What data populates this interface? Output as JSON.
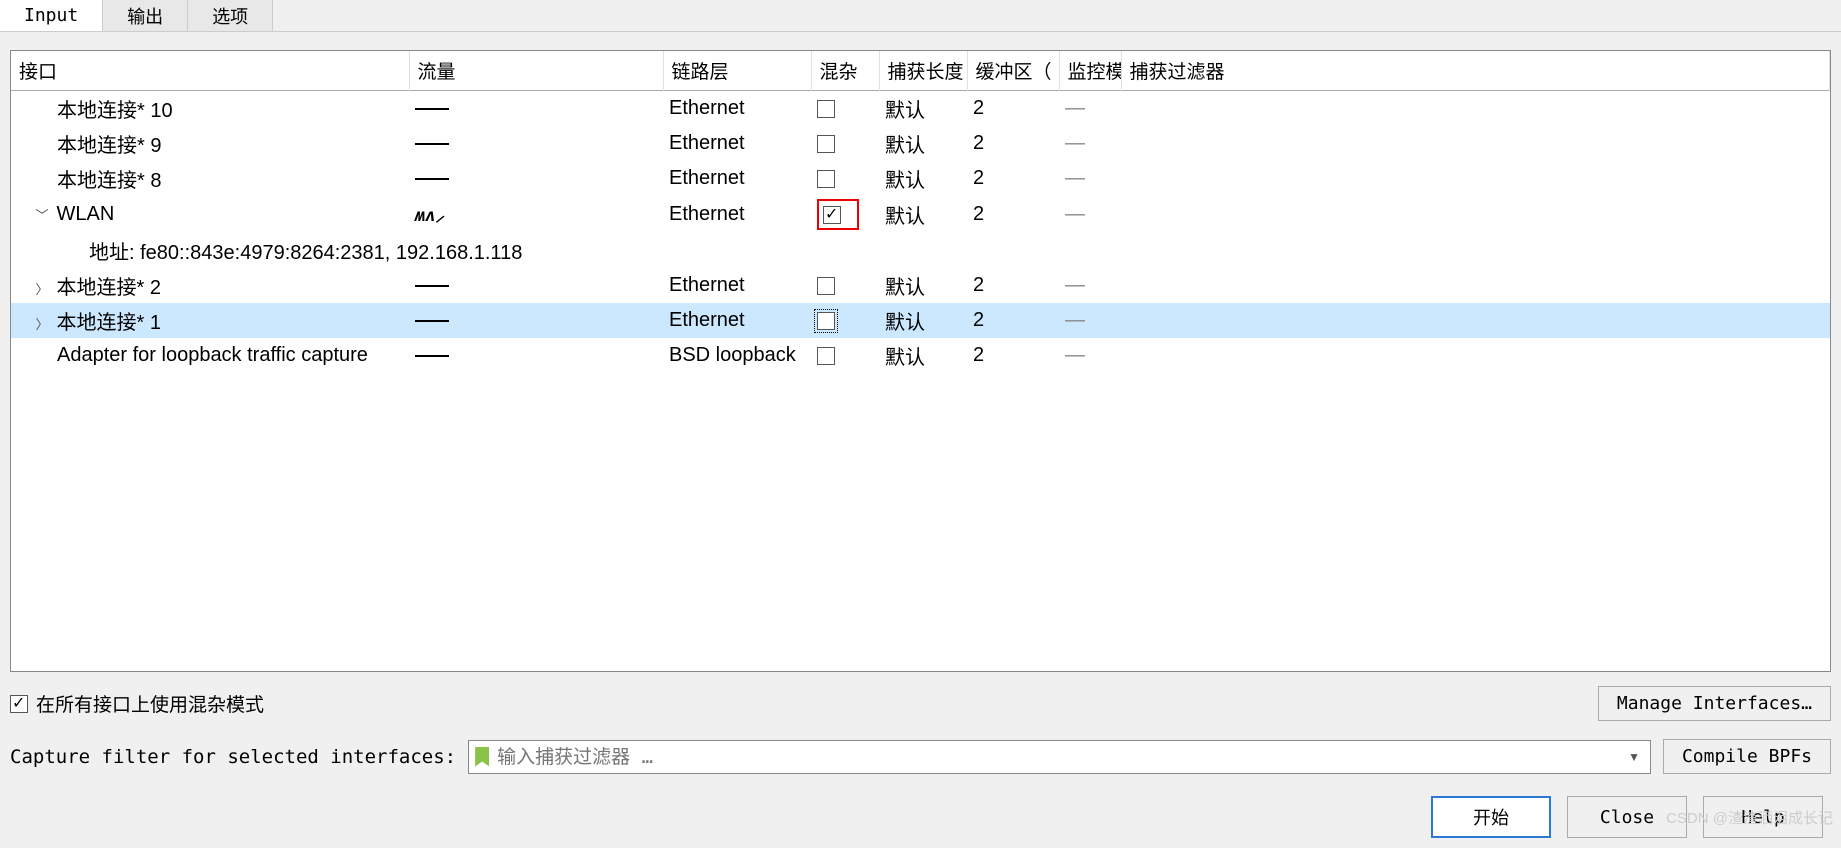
{
  "tabs": {
    "input": "Input",
    "output": "输出",
    "options": "选项"
  },
  "headers": {
    "interface": "接口",
    "traffic": "流量",
    "link": "链路层",
    "prom": "混杂",
    "caplen": "捕获长度",
    "buffer": "缓冲区（",
    "monitor": "监控模",
    "filter": "捕获过滤器"
  },
  "rows": [
    {
      "expand": "",
      "name": "本地连接* 10",
      "traffic": "flat",
      "link": "Ethernet",
      "prom": false,
      "caplen": "默认",
      "buf": "2",
      "mon": "—"
    },
    {
      "expand": "",
      "name": "本地连接* 9",
      "traffic": "flat",
      "link": "Ethernet",
      "prom": false,
      "caplen": "默认",
      "buf": "2",
      "mon": "—"
    },
    {
      "expand": "",
      "name": "本地连接* 8",
      "traffic": "flat",
      "link": "Ethernet",
      "prom": false,
      "caplen": "默认",
      "buf": "2",
      "mon": "—"
    },
    {
      "expand": "v",
      "name": "WLAN",
      "traffic": "wave",
      "link": "Ethernet",
      "prom": true,
      "prom_hl": true,
      "caplen": "默认",
      "buf": "2",
      "mon": "—"
    },
    {
      "expand": "addr",
      "addr": "地址: fe80::843e:4979:8264:2381, 192.168.1.118"
    },
    {
      "expand": ">",
      "name": "本地连接* 2",
      "traffic": "flat",
      "link": "Ethernet",
      "prom": false,
      "caplen": "默认",
      "buf": "2",
      "mon": "—"
    },
    {
      "expand": ">",
      "name": "本地连接* 1",
      "traffic": "flat",
      "link": "Ethernet",
      "prom": false,
      "prom_focus": true,
      "caplen": "默认",
      "buf": "2",
      "mon": "—",
      "selected": true
    },
    {
      "expand": "",
      "name": "Adapter for loopback traffic capture",
      "traffic": "flat",
      "link": "BSD loopback",
      "prom": false,
      "caplen": "默认",
      "buf": "2",
      "mon": "—"
    }
  ],
  "prom_all": {
    "checked": true,
    "label": "在所有接口上使用混杂模式"
  },
  "manage_btn": "Manage Interfaces…",
  "filter": {
    "label": "Capture filter for selected interfaces:",
    "placeholder": "输入捕获过滤器 …"
  },
  "compile_btn": "Compile BPFs",
  "bottom": {
    "start": "开始",
    "close": "Close",
    "help": "Help"
  },
  "watermark": "CSDN @渣渣洒泪成长记"
}
